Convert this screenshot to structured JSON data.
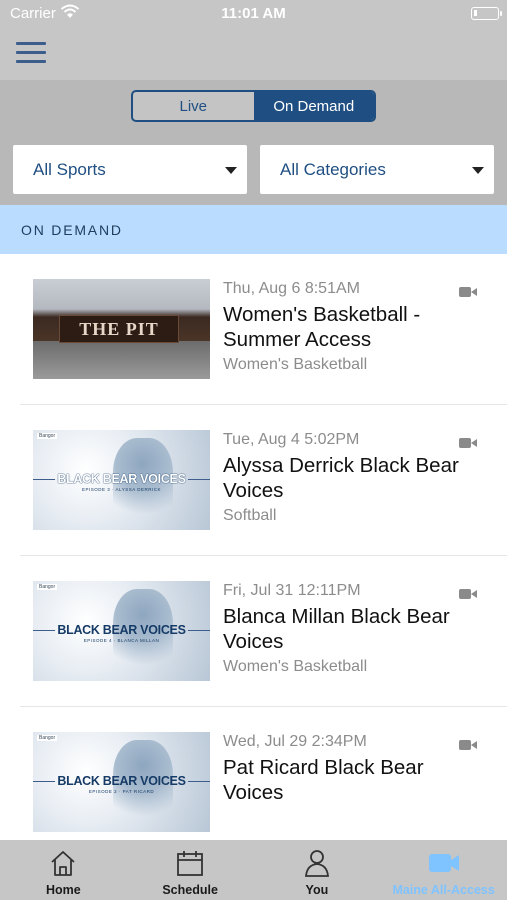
{
  "status_bar": {
    "carrier": "Carrier",
    "time": "11:01 AM"
  },
  "nav": {
    "menu_icon": "hamburger-menu-icon"
  },
  "segment": {
    "live_label": "Live",
    "on_demand_label": "On Demand",
    "selected": "On Demand"
  },
  "filters": {
    "sports_value": "All Sports",
    "categories_value": "All Categories"
  },
  "section": {
    "title": "ON DEMAND"
  },
  "items": [
    {
      "date": "Thu, Aug 6 8:51AM",
      "title": "Women's Basketball - Summer Access",
      "sport": "Women's Basketball",
      "thumb_text": "THE PIT"
    },
    {
      "date": "Tue, Aug 4 5:02PM",
      "title": "Alyssa Derrick Black Bear Voices",
      "sport": "Softball",
      "thumb_text": "BLACK BEAR VOICES"
    },
    {
      "date": "Fri, Jul 31 12:11PM",
      "title": "Blanca Millan Black Bear Voices",
      "sport": "Women's Basketball",
      "thumb_text": "BLACK BEAR VOICES"
    },
    {
      "date": "Wed, Jul 29 2:34PM",
      "title": "Pat Ricard Black Bear Voices",
      "sport": "",
      "thumb_text": "BLACK BEAR VOICES"
    }
  ],
  "tabs": [
    {
      "label": "Home",
      "icon": "home-icon"
    },
    {
      "label": "Schedule",
      "icon": "calendar-icon"
    },
    {
      "label": "You",
      "icon": "person-icon"
    },
    {
      "label": "Maine All-Access",
      "icon": "video-camera-icon"
    }
  ],
  "colors": {
    "accent": "#1f4f82",
    "section_bg": "#b9dcff",
    "active_tab": "#7fc3ff"
  }
}
